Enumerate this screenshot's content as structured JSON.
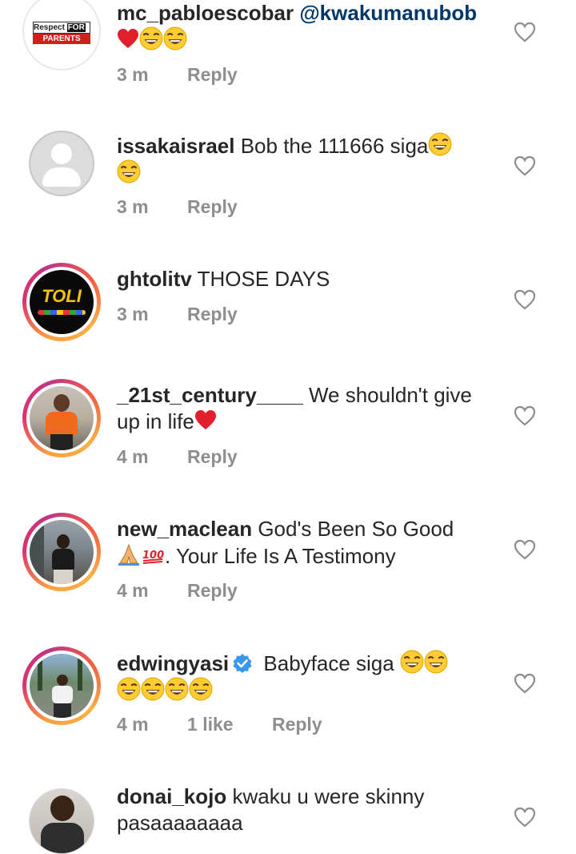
{
  "comments": [
    {
      "username": "mc_pabloescobar",
      "mention": "@kwakumanubob",
      "text": "",
      "emojis": [
        "heart",
        "laugh",
        "laugh"
      ],
      "time": "3 m",
      "likes": "",
      "reply": "Reply",
      "avatar_text_1": "Respect",
      "avatar_text_2": "FOR",
      "avatar_text_3": "PARENTS"
    },
    {
      "username": "issakaisrael",
      "text_line1": "Bob the 111666 siga",
      "time": "3 m",
      "reply": "Reply"
    },
    {
      "username": "ghtolitv",
      "text": "THOSE DAYS",
      "time": "3 m",
      "reply": "Reply",
      "avatar_text": "TOLI"
    },
    {
      "username": "_21st_century____",
      "text_line1": "We shouldn't give",
      "text_line2": "up in life",
      "time": "4 m",
      "reply": "Reply"
    },
    {
      "username": "new_maclean",
      "text_line1": "God's Been So Good",
      "text_line2": ". Your Life Is A Testimony",
      "time": "4 m",
      "reply": "Reply"
    },
    {
      "username": "edwingyasi",
      "text_line1": "Babyface siga",
      "time": "4 m",
      "likes": "1 like",
      "reply": "Reply"
    },
    {
      "username": "donai_kojo",
      "text_line1": "kwaku u were skinny",
      "text_line2": "pasaaaaaaaa"
    }
  ],
  "colors": {
    "link": "#00376b",
    "meta": "#8e8e8e",
    "verified": "#3897f0"
  }
}
